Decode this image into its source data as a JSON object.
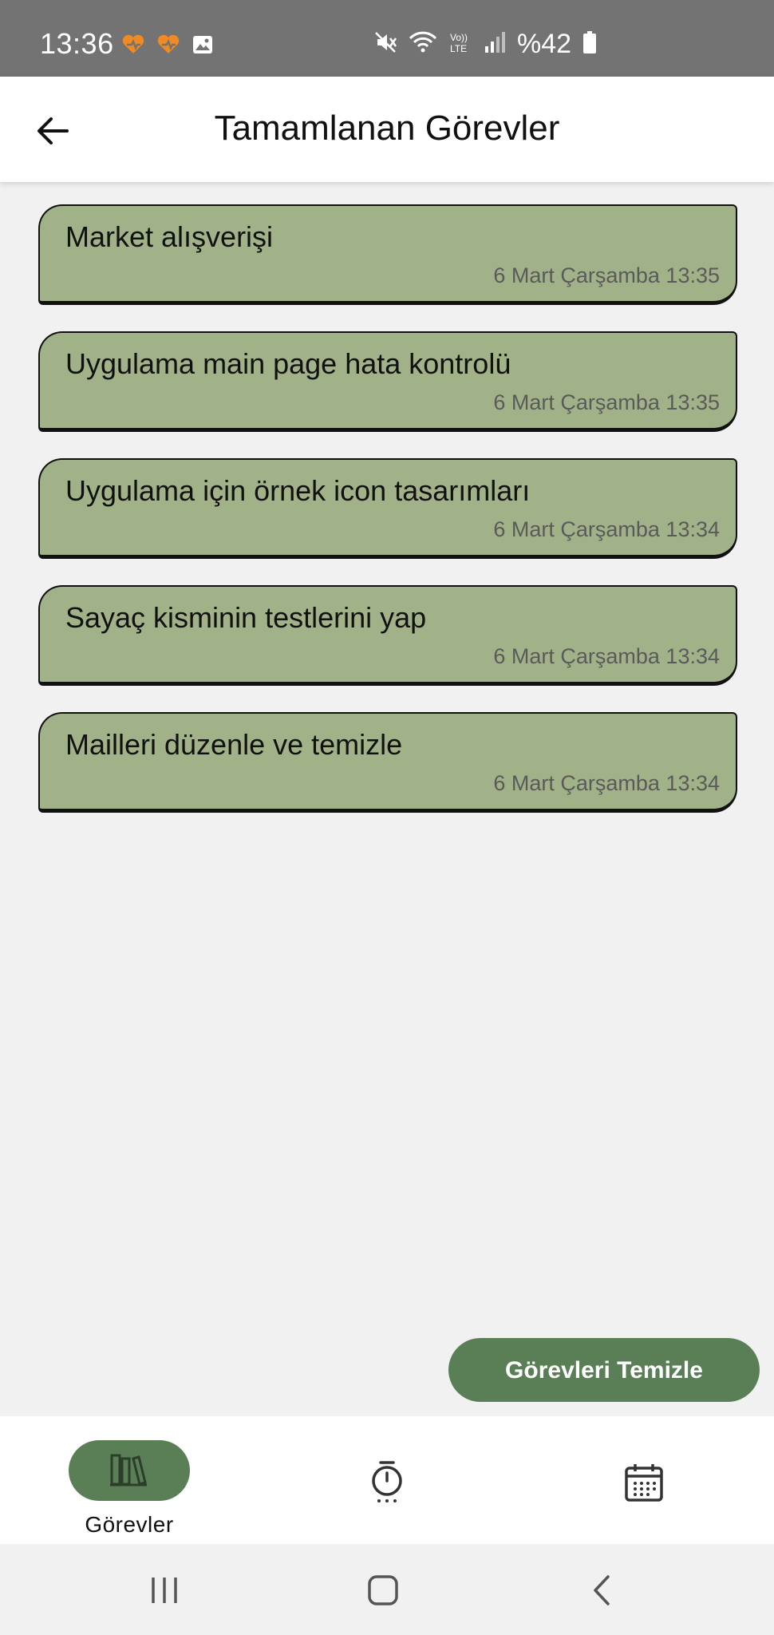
{
  "status_bar": {
    "time": "13:36",
    "battery": "%42",
    "icons": [
      "notification-heart-icon",
      "notification-heart-icon",
      "image-icon",
      "mute-icon",
      "wifi-icon",
      "volte-icon",
      "signal-icon",
      "battery-icon"
    ]
  },
  "header": {
    "title": "Tamamlanan Görevler",
    "back_icon": "arrow-left-icon"
  },
  "tasks": [
    {
      "title": "Market alışverişi",
      "date": "6 Mart Çarşamba 13:35"
    },
    {
      "title": "Uygulama main page hata kontrolü",
      "date": "6 Mart Çarşamba 13:35"
    },
    {
      "title": "Uygulama için örnek icon tasarımları",
      "date": "6 Mart Çarşamba 13:34"
    },
    {
      "title": "Sayaç kisminin testlerini yap",
      "date": "6 Mart Çarşamba 13:34"
    },
    {
      "title": "Mailleri düzenle ve temizle",
      "date": "6 Mart Çarşamba 13:34"
    }
  ],
  "clear_button": {
    "label": "Görevleri Temizle"
  },
  "bottom_nav": {
    "items": [
      {
        "label": "Görevler",
        "icon": "books-icon",
        "active": true
      },
      {
        "icon": "stopwatch-icon",
        "active": false
      },
      {
        "icon": "calendar-icon",
        "active": false
      }
    ]
  },
  "colors": {
    "card": "#a2b288",
    "accent": "#5a7f57",
    "status_bar": "#737373",
    "background": "#f1f1f1"
  }
}
